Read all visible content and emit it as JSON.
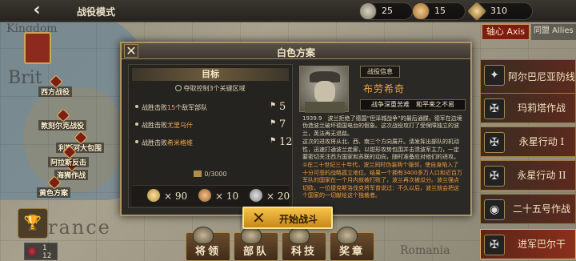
{
  "top_bar": {
    "back_icon": "back-arrow-icon",
    "title": "战役模式",
    "resources": [
      {
        "icon": "silver-medal-icon",
        "value": "25"
      },
      {
        "icon": "bronze-medal-icon",
        "value": "15"
      },
      {
        "icon": "star-medal-icon",
        "value": "310"
      }
    ]
  },
  "map": {
    "labels": {
      "kingdom": "Kingdom",
      "britain": "Brit",
      "france": "rance",
      "romania": "Romania"
    },
    "nodes": [
      "西方战役",
      "敦刻尔克战役",
      "利斯河大包围",
      "海狮作战",
      "阿拉斯反击",
      "黄色方案"
    ]
  },
  "factions": {
    "axis": "轴心 Axis",
    "allies": "同盟 Allies"
  },
  "campaign_list": [
    {
      "label": "阿尔巴尼亚防线",
      "icon": "albania-emblem-icon"
    },
    {
      "label": "玛莉塔作战",
      "icon": "iron-cross-icon"
    },
    {
      "label": "永星行动 I",
      "icon": "iron-cross-icon"
    },
    {
      "label": "永星行动 II",
      "icon": "iron-cross-icon"
    },
    {
      "label": "二十五号作战",
      "icon": "bulgaria-emblem-icon"
    },
    {
      "label": "进军巴尔干",
      "icon": "iron-cross-icon"
    }
  ],
  "dialog": {
    "title": "白色方案",
    "objective_header": "目标",
    "objective_sub": "夺取控制3个关键区域",
    "tasks": [
      {
        "pre": "战胜击败",
        "hl": "15",
        "post": "个敌军部队",
        "count": "5"
      },
      {
        "pre": "战胜击败",
        "hl": "尤里乌什",
        "post": "",
        "count": "7"
      },
      {
        "pre": "战胜击败",
        "hl": "希米格维",
        "post": "",
        "count": "12"
      }
    ],
    "progress": "0/3000",
    "rewards": [
      {
        "icon": "gold-medal-icon",
        "value": "× 90"
      },
      {
        "icon": "bronze-medal-icon",
        "value": "× 10"
      },
      {
        "icon": "silver-medal-icon",
        "value": "× 20"
      }
    ],
    "info_tag": "战役信息",
    "general_name": "布劳希奇",
    "traits": "战争深重苦难　和平来之不易",
    "story_p1": "1939.9　波兰拒绝了德国“但泽城战争”的最后通牒，德军在边境伪造波兰破坏德国电台的假象。这次战役攻打了受保障独立的波兰，英法再无退路。",
    "story_p2": "这次的进攻将从北、西、南三个方向展开。请发挥出部队的机动性，迅速打通波兰走廊，以钳形攻势包围并击溃波军主力，一定要密切关注西方国家和苏联的动向，随时准备应对他们的进攻。",
    "story_p3": "①在二十世纪三十年代，波兰同时伪装两个强邻，使自身陷入了十分可悲的战略孤立地位。结果一个拥有3400多万人口和近百万军队的国家在一个月内就被打败了，波兰再次被瓜分。波兰强点切欧，一位捷克斯洛伐克将军曾说过：不久以后，波兰就会把这个国家的一切献给这个独裁者。"
  },
  "start_button": "开始战斗",
  "bottom_nav": [
    "将领",
    "部队",
    "科技",
    "奖章"
  ],
  "page_indicator": {
    "current": "1",
    "total": "12"
  }
}
